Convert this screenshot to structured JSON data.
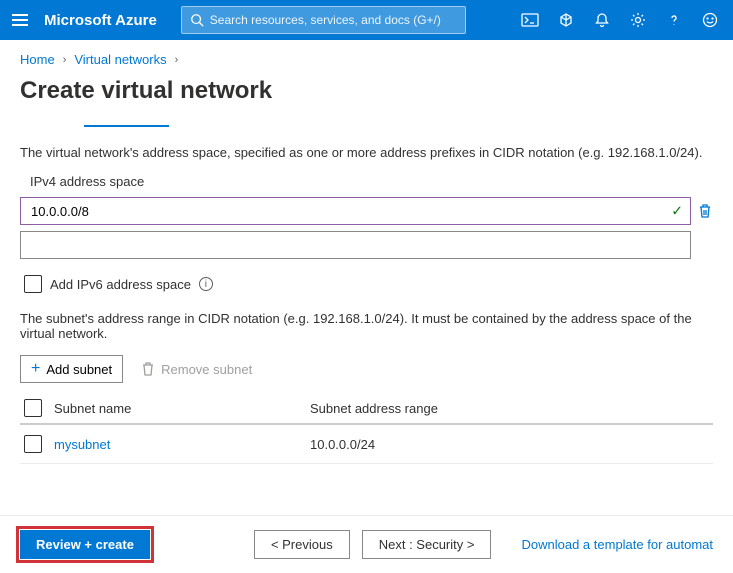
{
  "header": {
    "brand": "Microsoft Azure",
    "search_placeholder": "Search resources, services, and docs (G+/)"
  },
  "breadcrumb": {
    "home": "Home",
    "current": "Virtual networks"
  },
  "page": {
    "title": "Create virtual network",
    "address_desc": "The virtual network's address space, specified as one or more address prefixes in CIDR notation (e.g. 192.168.1.0/24).",
    "ipv4_label": "IPv4 address space",
    "address_value": "10.0.0.0/8",
    "ipv6_checkbox": "Add IPv6 address space",
    "subnet_desc": "The subnet's address range in CIDR notation (e.g. 192.168.1.0/24). It must be contained by the address space of the virtual network.",
    "add_subnet": "Add subnet",
    "remove_subnet": "Remove subnet",
    "col_name": "Subnet name",
    "col_range": "Subnet address range",
    "subnets": [
      {
        "name": "mysubnet",
        "range": "10.0.0.0/24"
      }
    ]
  },
  "footer": {
    "review": "Review + create",
    "previous": "< Previous",
    "next": "Next : Security >",
    "download": "Download a template for automat"
  }
}
